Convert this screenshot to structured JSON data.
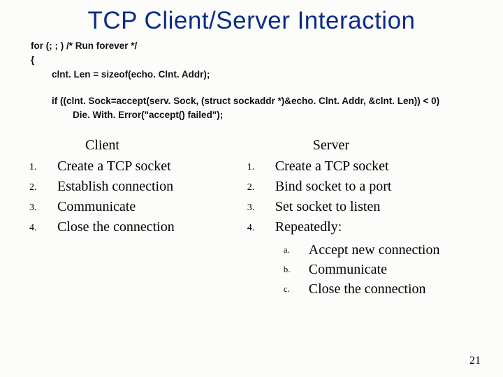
{
  "title": "TCP Client/Server Interaction",
  "code": {
    "l1": "for (; ; ) /* Run forever */",
    "l2": "{",
    "l3": "clnt. Len = sizeof(echo. Clnt. Addr);",
    "l4": "if ((clnt. Sock=accept(serv. Sock, (struct sockaddr *)&echo. Clnt. Addr, &clnt. Len)) < 0)",
    "l5": "Die. With. Error(\"accept() failed\");"
  },
  "client": {
    "heading": "Client",
    "items": [
      "Create a TCP socket",
      "Establish connection",
      "Communicate",
      "Close the connection"
    ]
  },
  "server": {
    "heading": "Server",
    "items": [
      "Create a TCP socket",
      "Bind socket to a port",
      "Set socket to listen",
      "Repeatedly:"
    ],
    "subitems": [
      "Accept new connection",
      "Communicate",
      "Close the connection"
    ]
  },
  "page_number": "21"
}
